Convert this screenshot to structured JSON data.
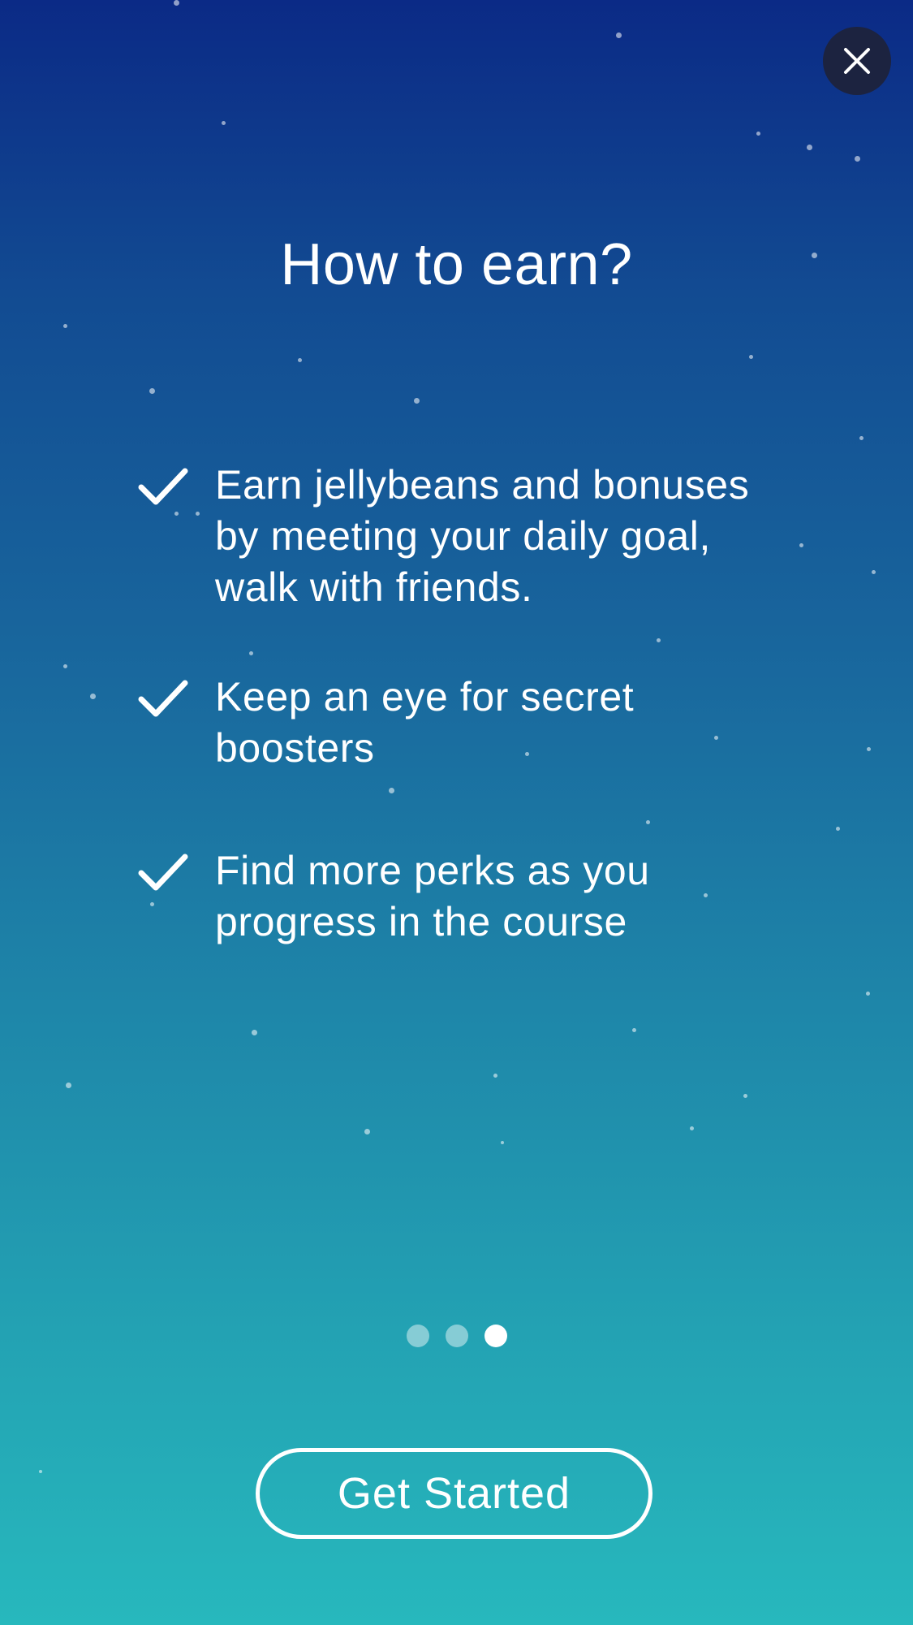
{
  "title": "How to earn?",
  "bullets": [
    {
      "text": "Earn jellybeans and bonuses by meeting your daily goal, walk with friends.",
      "icon": "checkmark-icon"
    },
    {
      "text": "Keep an eye for secret boosters",
      "icon": "checkmark-icon"
    },
    {
      "text": "Find more perks as you progress in the course",
      "icon": "checkmark-icon"
    }
  ],
  "pagination": {
    "total": 3,
    "active_index": 2
  },
  "cta_label": "Get Started",
  "close_icon": "close-icon",
  "colors": {
    "gradient_top": "#0b2a86",
    "gradient_bottom": "#27b8bd",
    "close_button_bg": "#1c2340",
    "text": "#ffffff"
  }
}
